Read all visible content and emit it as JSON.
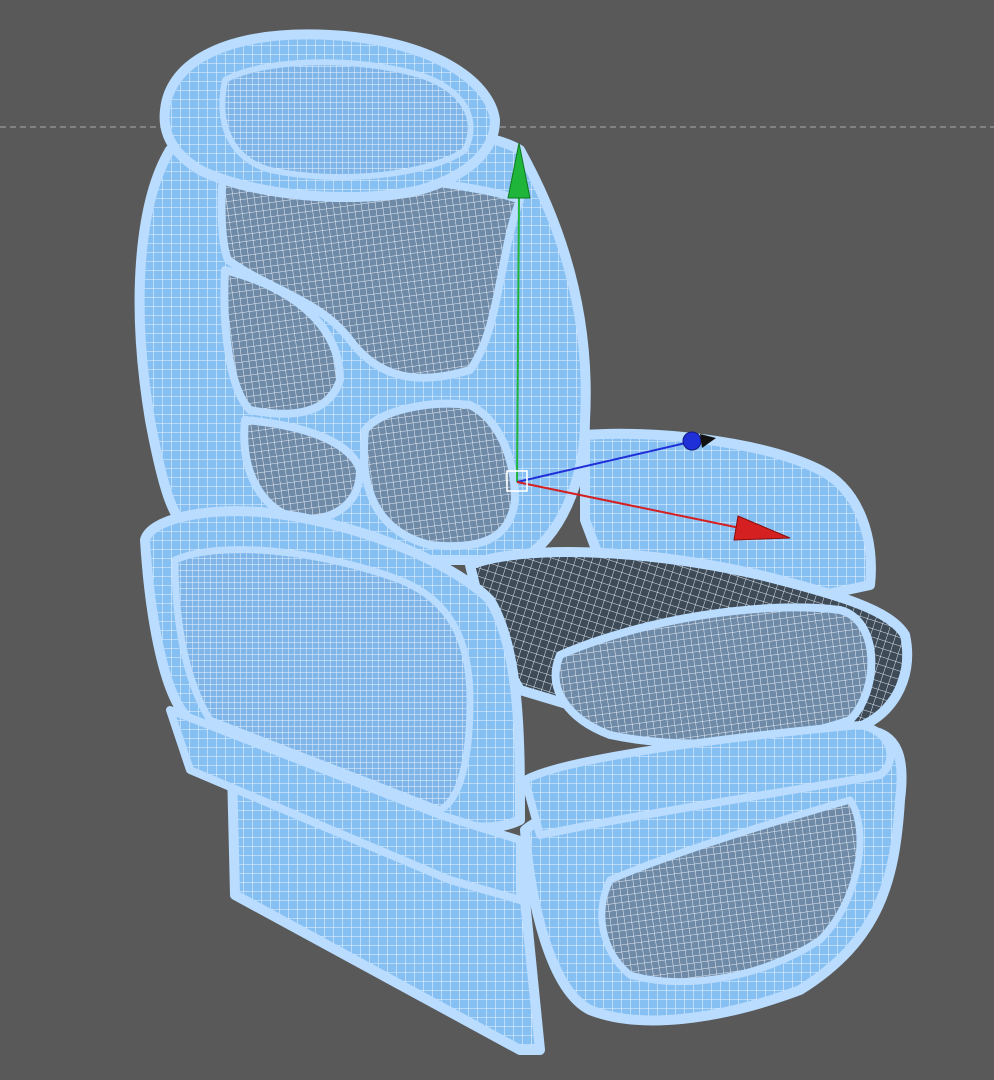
{
  "viewport": {
    "background": "#595959",
    "wire_color": "#ffffff",
    "mesh_fill": "#8ec6f5",
    "mesh_shadow": "#7ab3e6",
    "horizon_line_color": "#9a9a9a"
  },
  "model": {
    "object": "reclining-seat",
    "display_mode": "wireframe-on-shaded",
    "selected": true
  },
  "gizmo": {
    "type": "move-manipulator",
    "axes": [
      {
        "axis": "y",
        "color": "#1fb53a"
      },
      {
        "axis": "x",
        "color": "#d42020"
      },
      {
        "axis": "z",
        "color": "#2030d8"
      }
    ],
    "pivot_color": "#ffffff"
  }
}
